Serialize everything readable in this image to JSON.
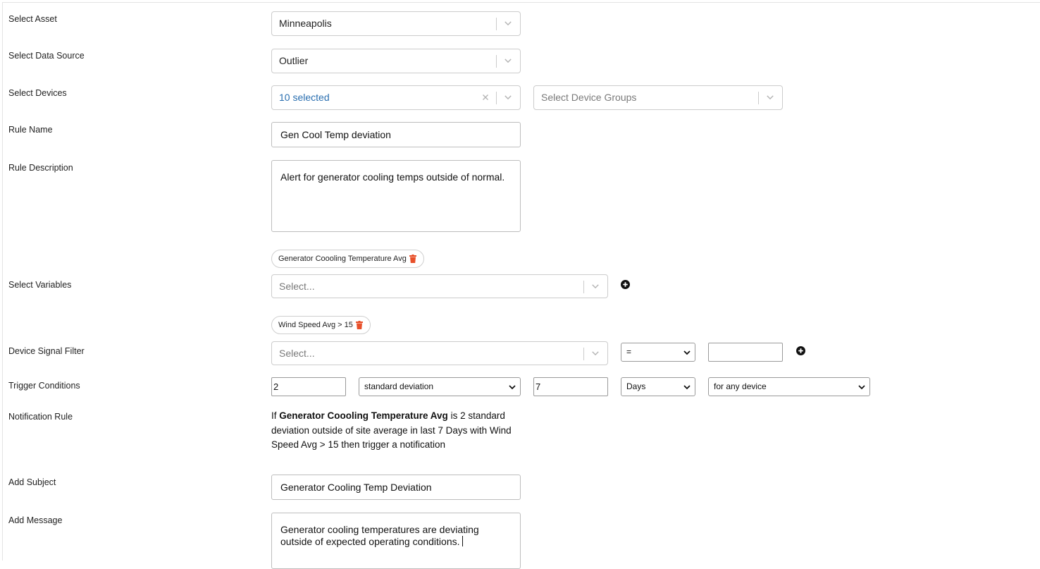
{
  "labels": {
    "asset": "Select Asset",
    "data_source": "Select Data Source",
    "devices": "Select Devices",
    "rule_name": "Rule Name",
    "rule_description": "Rule Description",
    "variables": "Select Variables",
    "signal_filter": "Device Signal Filter",
    "trigger": "Trigger Conditions",
    "notification_rule": "Notification Rule",
    "subject": "Add Subject",
    "message": "Add Message"
  },
  "asset": {
    "value": "Minneapolis"
  },
  "data_source": {
    "value": "Outlier"
  },
  "devices": {
    "value": "10 selected",
    "groups_placeholder": "Select Device Groups"
  },
  "rule_name": {
    "value": "Gen Cool Temp deviation"
  },
  "rule_description": {
    "value": "Alert for generator cooling temps outside of normal."
  },
  "variables": {
    "chips": [
      {
        "label": "Generator Coooling Temperature Avg"
      }
    ],
    "placeholder": "Select..."
  },
  "signal_filter": {
    "chips": [
      {
        "label": "Wind Speed Avg > 15"
      }
    ],
    "placeholder": "Select...",
    "operator": "=",
    "value": ""
  },
  "trigger": {
    "threshold": "2",
    "method": "standard deviation",
    "period": "7",
    "unit": "Days",
    "scope": "for any device"
  },
  "notification_rule": {
    "prefix": "If ",
    "variable": "Generator Coooling Temperature Avg",
    "suffix": " is 2 standard deviation outside of site average in last 7 Days with Wind Speed Avg > 15 then trigger a notification"
  },
  "subject": {
    "value": "Generator Cooling Temp Deviation"
  },
  "message": {
    "value": "Generator cooling temperatures are deviating outside of expected operating conditions."
  },
  "colors": {
    "multi_value": "#2a6fb0",
    "trash": "#e8502a",
    "border": "#cccccc"
  },
  "icons": {
    "chevron": "chevron-down-icon",
    "clear": "close-icon",
    "trash": "trash-icon",
    "add": "plus-circle-icon"
  }
}
